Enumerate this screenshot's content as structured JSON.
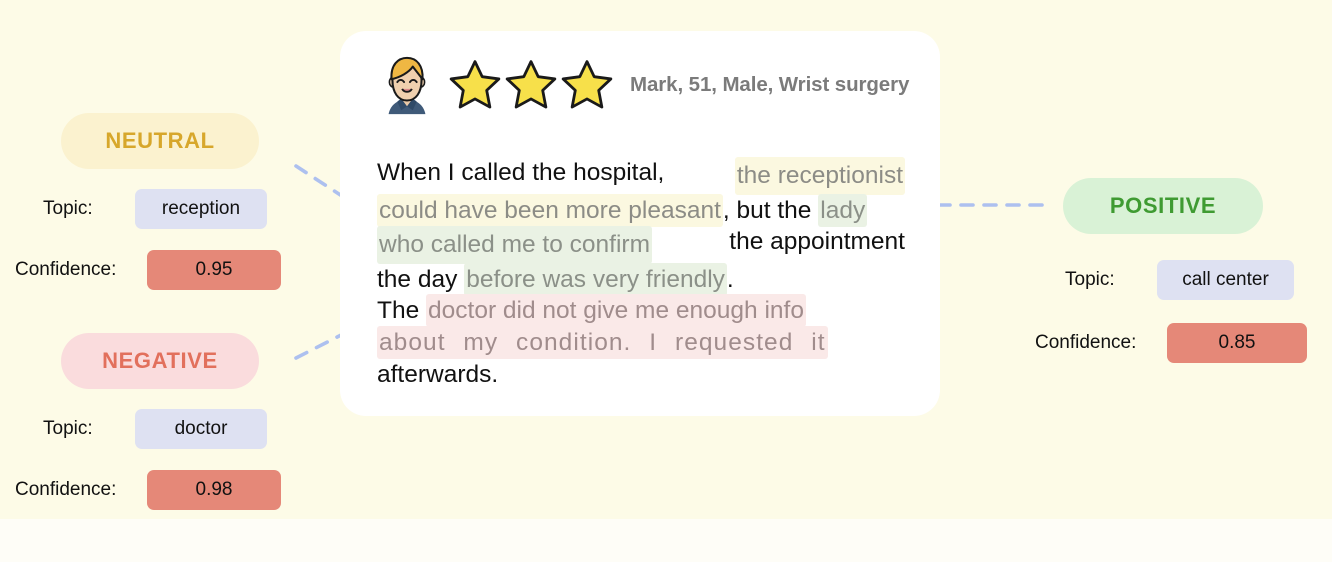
{
  "background": {
    "page_color": "#fdfbe7",
    "card_color": "#ffffff"
  },
  "review_card": {
    "avatar_icon": "person-blond-avatar-icon",
    "rating": {
      "stars_filled": 3,
      "star_icon": "star-icon",
      "star_color": "#f7e04a"
    },
    "reviewer_meta": "Mark, 51, Male, Wrist surgery",
    "review_text_segments": [
      {
        "text": "When I called the hospital, ",
        "highlight": "none"
      },
      {
        "text": "the receptionist could have been more pleasant",
        "highlight": "neutral"
      },
      {
        "text": ", but the ",
        "highlight": "none"
      },
      {
        "text": "lady who called me to confirm",
        "highlight": "positive"
      },
      {
        "text": " the appointment the day ",
        "highlight": "none"
      },
      {
        "text": "before was very friendly",
        "highlight": "positive"
      },
      {
        "text": ". The ",
        "highlight": "none"
      },
      {
        "text": "doctor did not give me enough info about my condition. I requested it",
        "highlight": "negative"
      },
      {
        "text": " afterwards.",
        "highlight": "none"
      }
    ],
    "lines": [
      {
        "id": "l1",
        "parts": [
          {
            "t": "When I called the hospital,",
            "h": "none"
          },
          {
            "t": "the receptionist",
            "h": "neutral"
          }
        ]
      },
      {
        "id": "l2",
        "parts": [
          {
            "t": "could have been more pleasant",
            "h": "neutral"
          },
          {
            "t": ", but the ",
            "h": "none"
          },
          {
            "t": "lady",
            "h": "positive"
          }
        ]
      },
      {
        "id": "l3",
        "parts": [
          {
            "t": "who called me to confirm",
            "h": "positive"
          },
          {
            "t": "the appointment",
            "h": "none"
          }
        ]
      },
      {
        "id": "l4",
        "parts": [
          {
            "t": "the day ",
            "h": "none"
          },
          {
            "t": "before was very friendly",
            "h": "positive"
          },
          {
            "t": ".",
            "h": "none"
          }
        ]
      },
      {
        "id": "l5",
        "parts": [
          {
            "t": "The ",
            "h": "none"
          },
          {
            "t": "doctor did not give me enough info",
            "h": "negative"
          }
        ]
      },
      {
        "id": "l6",
        "parts": [
          {
            "t": "about my condition. I requested it",
            "h": "negative"
          }
        ]
      },
      {
        "id": "l7",
        "parts": [
          {
            "t": "afterwards.",
            "h": "none"
          }
        ]
      }
    ]
  },
  "annotations": [
    {
      "id": "neutral",
      "sentiment_label": "NEUTRAL",
      "pill_bg": "#fbf2cf",
      "pill_fg": "#d7a72b",
      "topic_label": "Topic:",
      "topic_value": "reception",
      "topic_bg": "#dee1f2",
      "confidence_label": "Confidence:",
      "confidence_value": "0.95",
      "confidence_bg": "#e58878"
    },
    {
      "id": "negative",
      "sentiment_label": "NEGATIVE",
      "pill_bg": "#fadcdd",
      "pill_fg": "#e2705c",
      "topic_label": "Topic:",
      "topic_value": "doctor",
      "topic_bg": "#dee1f2",
      "confidence_label": "Confidence:",
      "confidence_value": "0.98",
      "confidence_bg": "#e58878"
    },
    {
      "id": "positive",
      "sentiment_label": "POSITIVE",
      "pill_bg": "#d9f2d6",
      "pill_fg": "#3f9b32",
      "topic_label": "Topic:",
      "topic_value": "call center",
      "topic_bg": "#dee1f2",
      "confidence_label": "Confidence:",
      "confidence_value": "0.85",
      "confidence_bg": "#e58878"
    }
  ],
  "connectors": {
    "dot_color": "#adc0ef",
    "line_color": "#adc0ef",
    "items": [
      {
        "id": "connector-neutral",
        "from": "neutral-panel",
        "to": "receptionist-highlight"
      },
      {
        "id": "connector-negative",
        "from": "negative-panel",
        "to": "doctor-highlight"
      },
      {
        "id": "connector-positive",
        "from": "lady-highlight",
        "to": "positive-panel"
      }
    ]
  }
}
